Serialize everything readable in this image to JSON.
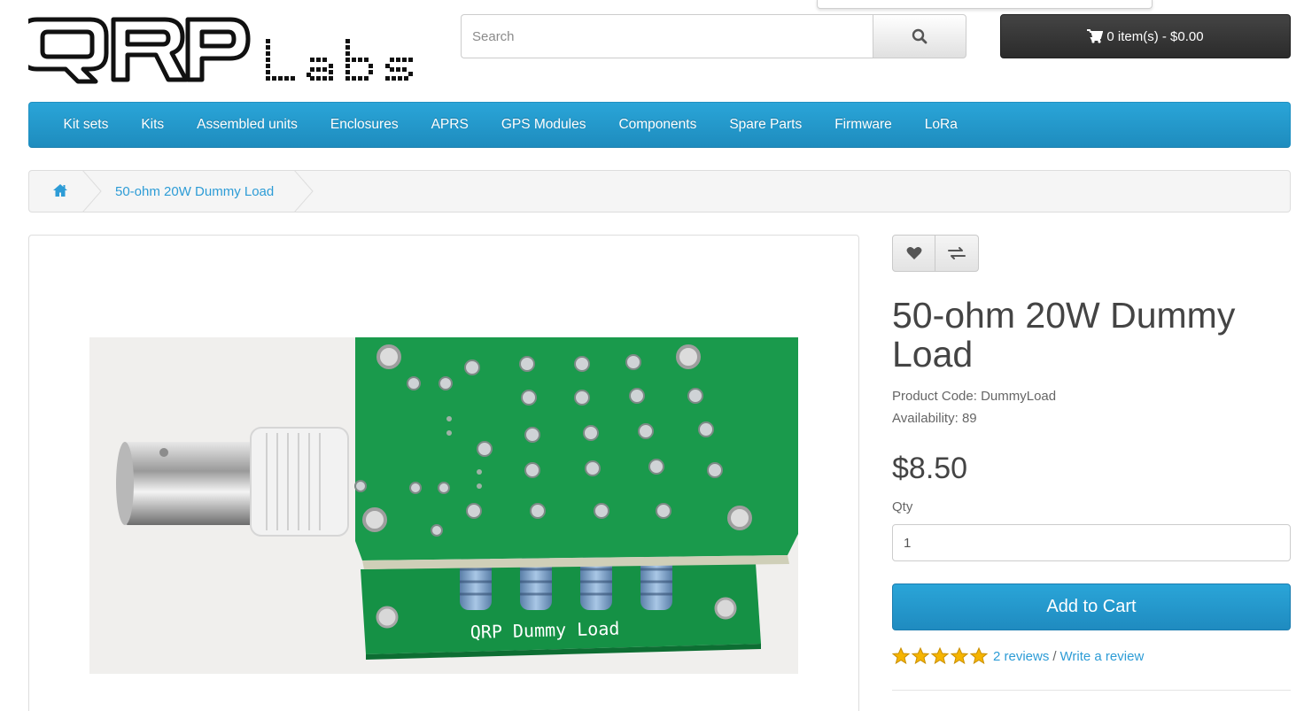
{
  "header": {
    "logo_alt": "QRP Labs",
    "search": {
      "placeholder": "Search",
      "value": ""
    },
    "cart": {
      "label": "0 item(s) - $0.00"
    }
  },
  "menu": {
    "items": [
      {
        "label": "Kit sets"
      },
      {
        "label": "Kits"
      },
      {
        "label": "Assembled units"
      },
      {
        "label": "Enclosures"
      },
      {
        "label": "APRS"
      },
      {
        "label": "GPS Modules"
      },
      {
        "label": "Components"
      },
      {
        "label": "Spare Parts"
      },
      {
        "label": "Firmware"
      },
      {
        "label": "LoRa"
      }
    ]
  },
  "breadcrumb": {
    "home_icon": "home-icon",
    "current": "50-ohm 20W Dummy Load"
  },
  "product": {
    "image_label": "QRP Dummy Load",
    "title": "50-ohm 20W Dummy Load",
    "code_label": "Product Code:",
    "code": "DummyLoad",
    "availability_label": "Availability:",
    "availability": "89",
    "price": "$8.50",
    "qty_label": "Qty",
    "qty_value": "1",
    "add_to_cart": "Add to Cart",
    "rating": 5,
    "reviews_link": "2 reviews",
    "write_review_link": "Write a review"
  },
  "colors": {
    "accent": "#229ad3",
    "cart_bg": "#333333",
    "link": "#2d9cd6",
    "star": "#f5b400"
  }
}
